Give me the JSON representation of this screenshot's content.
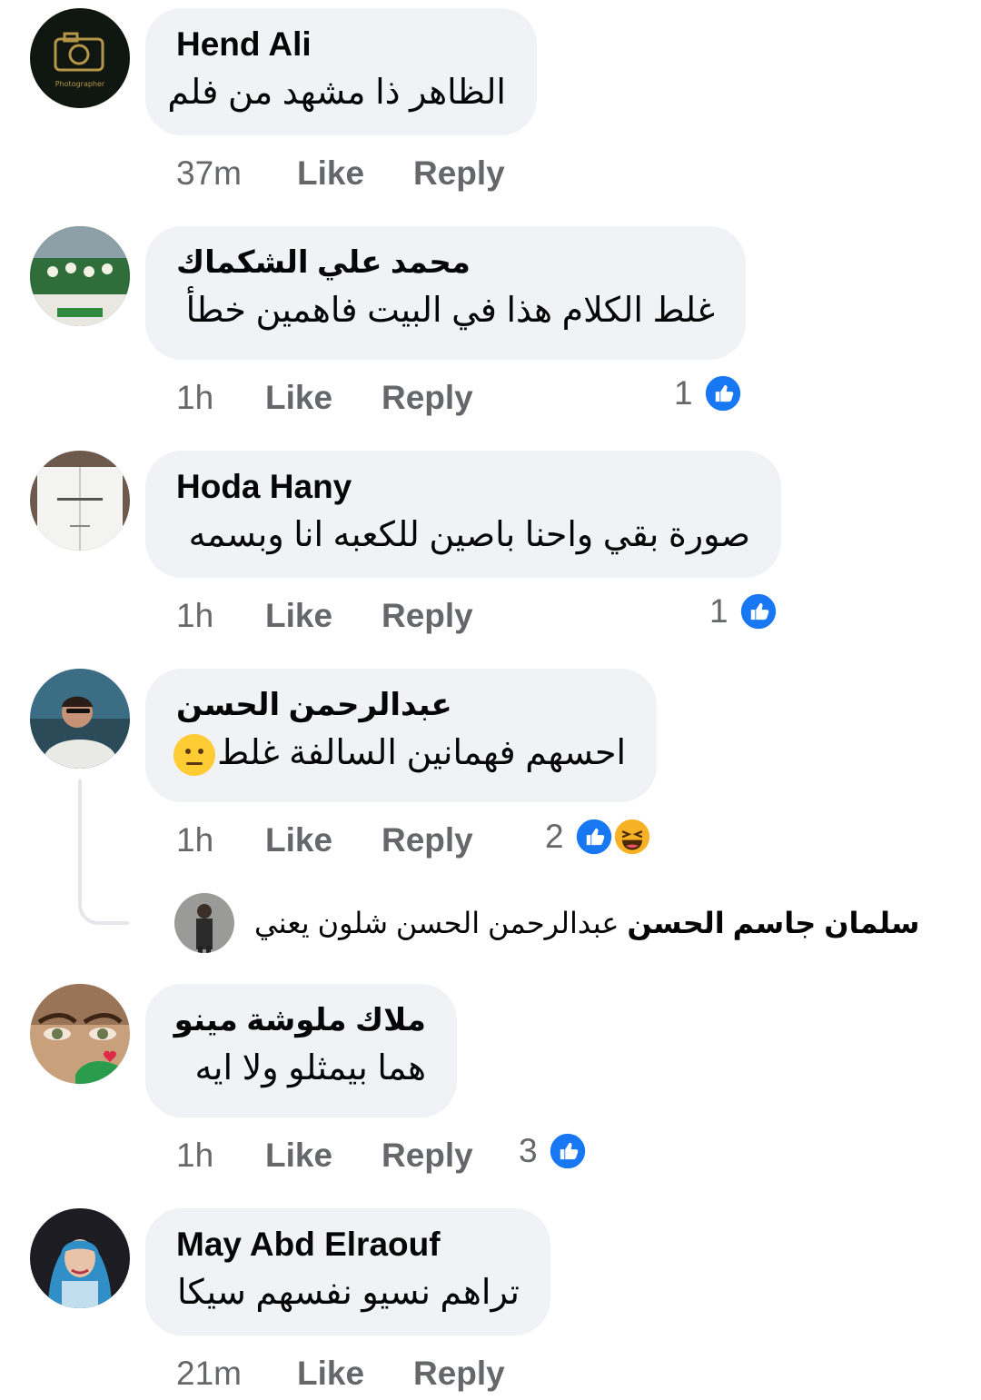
{
  "actions": {
    "like_label": "Like",
    "reply_label": "Reply"
  },
  "comments": [
    {
      "author": "Hend Ali",
      "text": "الظاهر ذا مشهد من فلم",
      "time": "37m",
      "reaction_count": "",
      "reactions": []
    },
    {
      "author": "محمد علي الشكماك",
      "text": "غلط الكلام هذا في البيت فاهمين خطأ",
      "time": "1h",
      "reaction_count": "1",
      "reactions": [
        "like-icon"
      ]
    },
    {
      "author": "Hoda Hany",
      "text": "صورة بقي واحنا باصين للكعبه انا وبسمه",
      "time": "1h",
      "reaction_count": "1",
      "reactions": [
        "like-icon"
      ]
    },
    {
      "author": "عبدالرحمن الحسن",
      "text": "احسهم فهمانين السالفة غلط",
      "emoji": "neutral-face-emoji",
      "time": "1h",
      "reaction_count": "2",
      "reactions": [
        "like-icon",
        "laughing-icon"
      ],
      "reply_preview": {
        "author": "سلمان جاسم الحسن",
        "text": "عبدالرحمن الحسن شلون يعني"
      }
    },
    {
      "author": "ملاك ملوشة مينو",
      "text": "هما بيمثلو ولا ايه",
      "time": "1h",
      "reaction_count": "3",
      "reactions": [
        "like-icon"
      ]
    },
    {
      "author": "May Abd Elraouf",
      "text": "تراهم نسيو نفسهم سيكا",
      "time": "21m",
      "reaction_count": "",
      "reactions": []
    }
  ],
  "colors": {
    "bubble_bg": "#f0f2f5",
    "meta_text": "#65676b",
    "like_blue": "#1877f2",
    "laugh_yellow": "#f7b125"
  }
}
